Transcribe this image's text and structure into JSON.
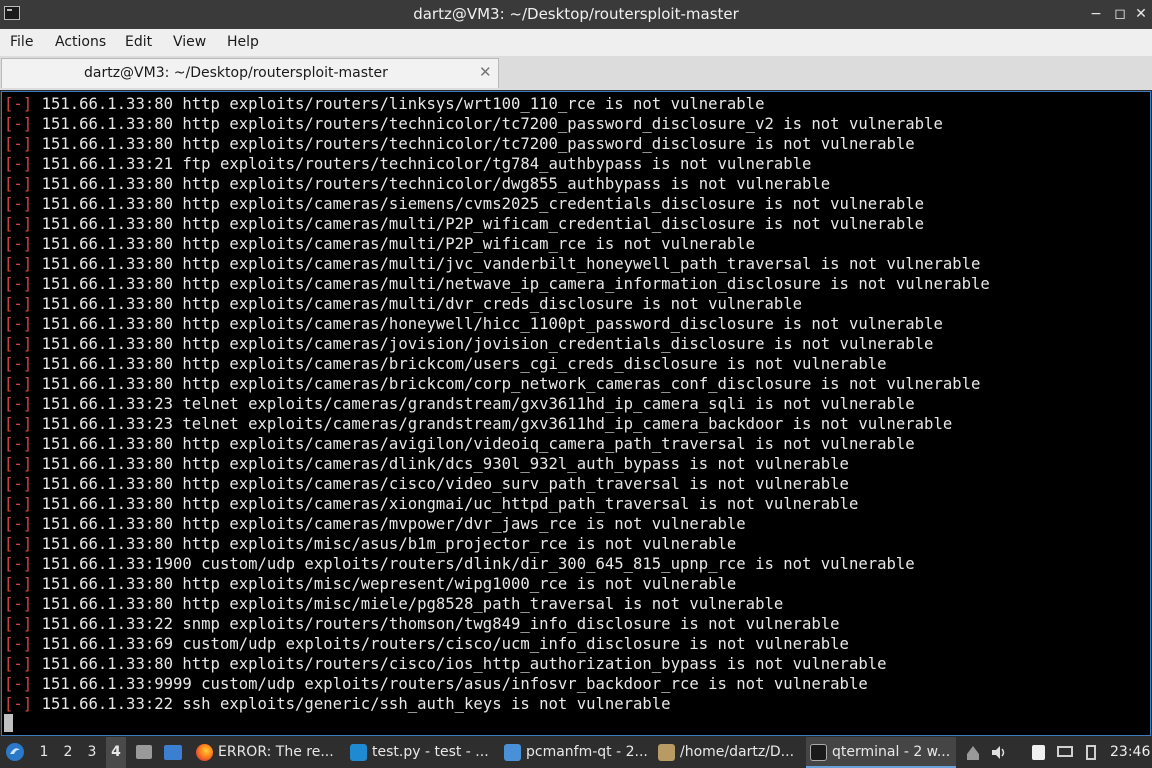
{
  "window": {
    "title": "dartz@VM3: ~/Desktop/routersploit-master",
    "buttons": {
      "minimize": "−",
      "maximize": "◻",
      "close": "✕"
    }
  },
  "menubar": {
    "items": [
      "File",
      "Actions",
      "Edit",
      "View",
      "Help"
    ]
  },
  "tab": {
    "label": "dartz@VM3: ~/Desktop/routersploit-master",
    "close": "✕"
  },
  "terminal": {
    "prefix": "[-]",
    "lines": [
      "151.66.1.33:80 http exploits/routers/linksys/wrt100_110_rce is not vulnerable",
      "151.66.1.33:80 http exploits/routers/technicolor/tc7200_password_disclosure_v2 is not vulnerable",
      "151.66.1.33:80 http exploits/routers/technicolor/tc7200_password_disclosure is not vulnerable",
      "151.66.1.33:21 ftp exploits/routers/technicolor/tg784_authbypass is not vulnerable",
      "151.66.1.33:80 http exploits/routers/technicolor/dwg855_authbypass is not vulnerable",
      "151.66.1.33:80 http exploits/cameras/siemens/cvms2025_credentials_disclosure is not vulnerable",
      "151.66.1.33:80 http exploits/cameras/multi/P2P_wificam_credential_disclosure is not vulnerable",
      "151.66.1.33:80 http exploits/cameras/multi/P2P_wificam_rce is not vulnerable",
      "151.66.1.33:80 http exploits/cameras/multi/jvc_vanderbilt_honeywell_path_traversal is not vulnerable",
      "151.66.1.33:80 http exploits/cameras/multi/netwave_ip_camera_information_disclosure is not vulnerable",
      "151.66.1.33:80 http exploits/cameras/multi/dvr_creds_disclosure is not vulnerable",
      "151.66.1.33:80 http exploits/cameras/honeywell/hicc_1100pt_password_disclosure is not vulnerable",
      "151.66.1.33:80 http exploits/cameras/jovision/jovision_credentials_disclosure is not vulnerable",
      "151.66.1.33:80 http exploits/cameras/brickcom/users_cgi_creds_disclosure is not vulnerable",
      "151.66.1.33:80 http exploits/cameras/brickcom/corp_network_cameras_conf_disclosure is not vulnerable",
      "151.66.1.33:23 telnet exploits/cameras/grandstream/gxv3611hd_ip_camera_sqli is not vulnerable",
      "151.66.1.33:23 telnet exploits/cameras/grandstream/gxv3611hd_ip_camera_backdoor is not vulnerable",
      "151.66.1.33:80 http exploits/cameras/avigilon/videoiq_camera_path_traversal is not vulnerable",
      "151.66.1.33:80 http exploits/cameras/dlink/dcs_930l_932l_auth_bypass is not vulnerable",
      "151.66.1.33:80 http exploits/cameras/cisco/video_surv_path_traversal is not vulnerable",
      "151.66.1.33:80 http exploits/cameras/xiongmai/uc_httpd_path_traversal is not vulnerable",
      "151.66.1.33:80 http exploits/cameras/mvpower/dvr_jaws_rce is not vulnerable",
      "151.66.1.33:80 http exploits/misc/asus/b1m_projector_rce is not vulnerable",
      "151.66.1.33:1900 custom/udp exploits/routers/dlink/dir_300_645_815_upnp_rce is not vulnerable",
      "151.66.1.33:80 http exploits/misc/wepresent/wipg1000_rce is not vulnerable",
      "151.66.1.33:80 http exploits/misc/miele/pg8528_path_traversal is not vulnerable",
      "151.66.1.33:22 snmp exploits/routers/thomson/twg849_info_disclosure is not vulnerable",
      "151.66.1.33:69 custom/udp exploits/routers/cisco/ucm_info_disclosure is not vulnerable",
      "151.66.1.33:80 http exploits/routers/cisco/ios_http_authorization_bypass is not vulnerable",
      "151.66.1.33:9999 custom/udp exploits/routers/asus/infosvr_backdoor_rce is not vulnerable",
      "151.66.1.33:22 ssh exploits/generic/ssh_auth_keys is not vulnerable"
    ]
  },
  "taskbar": {
    "workspaces": [
      "1",
      "2",
      "3",
      "4"
    ],
    "active_workspace": "4",
    "tasks": [
      {
        "label": "ERROR: The re...",
        "icon": "firefox-icon"
      },
      {
        "label": "test.py - test - ...",
        "icon": "vscode-icon"
      },
      {
        "label": "pcmanfm-qt - 2...",
        "icon": "folder-icon"
      },
      {
        "label": "/home/dartz/D...",
        "icon": "file-manager-icon"
      },
      {
        "label": "qterminal - 2 w...",
        "icon": "terminal-icon"
      }
    ],
    "clock": "23:46"
  },
  "colors": {
    "terminal_bg": "#000000",
    "terminal_fg": "#e8e8e8",
    "error_bracket": "#d24747",
    "titlebar_bg": "#3a3a3a",
    "taskbar_bg": "#2e2e2e"
  }
}
